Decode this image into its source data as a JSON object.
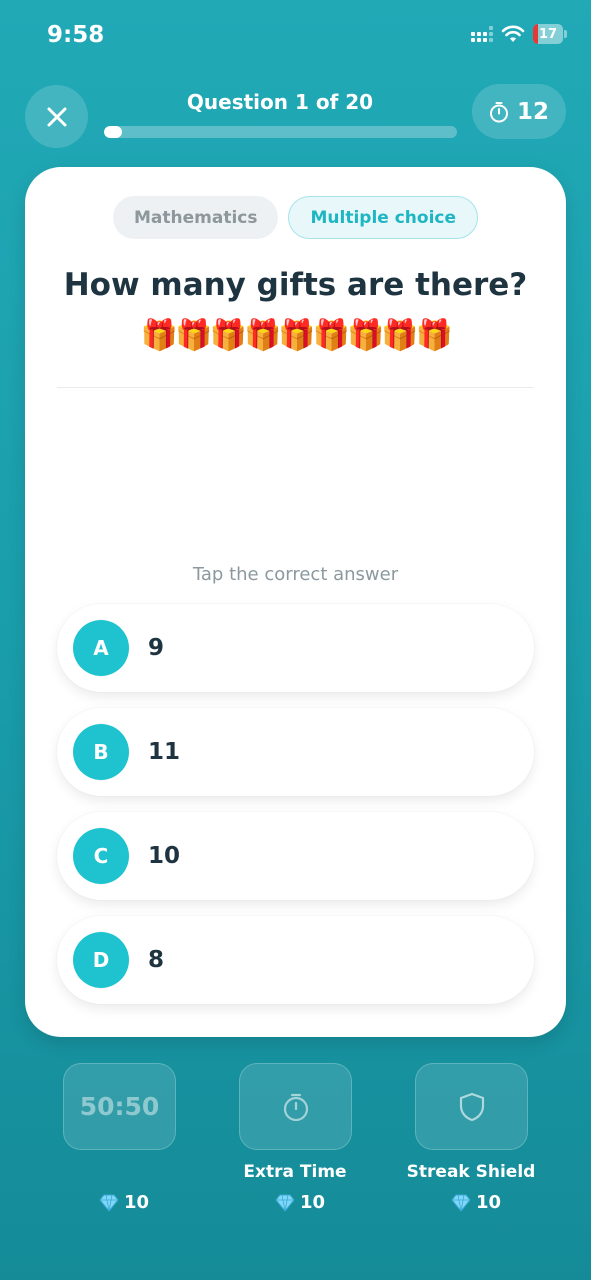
{
  "status_bar": {
    "time": "9:58",
    "battery": "17",
    "battery_level": 0.17
  },
  "header": {
    "title": "Question 1 of 20",
    "progress": 0.05,
    "timer": "12"
  },
  "question_card": {
    "tags": {
      "subject": "Mathematics",
      "type": "Multiple choice"
    },
    "question": "How many gifts are there?",
    "gifts": "🎁🎁🎁🎁🎁🎁🎁🎁🎁",
    "instruction": "Tap the correct answer",
    "options": [
      {
        "letter": "A",
        "value": "9"
      },
      {
        "letter": "B",
        "value": "11"
      },
      {
        "letter": "C",
        "value": "10"
      },
      {
        "letter": "D",
        "value": "8"
      }
    ]
  },
  "lifelines": [
    {
      "name": "50:50",
      "button_text": "50:50",
      "label": "",
      "cost": "10",
      "icon": "text"
    },
    {
      "name": "Extra Time",
      "button_text": "",
      "label": "Extra Time",
      "cost": "10",
      "icon": "stopwatch-icon"
    },
    {
      "name": "Streak Shield",
      "button_text": "",
      "label": "Streak Shield",
      "cost": "10",
      "icon": "shield-icon"
    }
  ],
  "colors": {
    "background": "#1aa0ae",
    "accent": "#1fc3cf",
    "text_dark": "#1e3440",
    "gem": "#7fd8f5"
  }
}
